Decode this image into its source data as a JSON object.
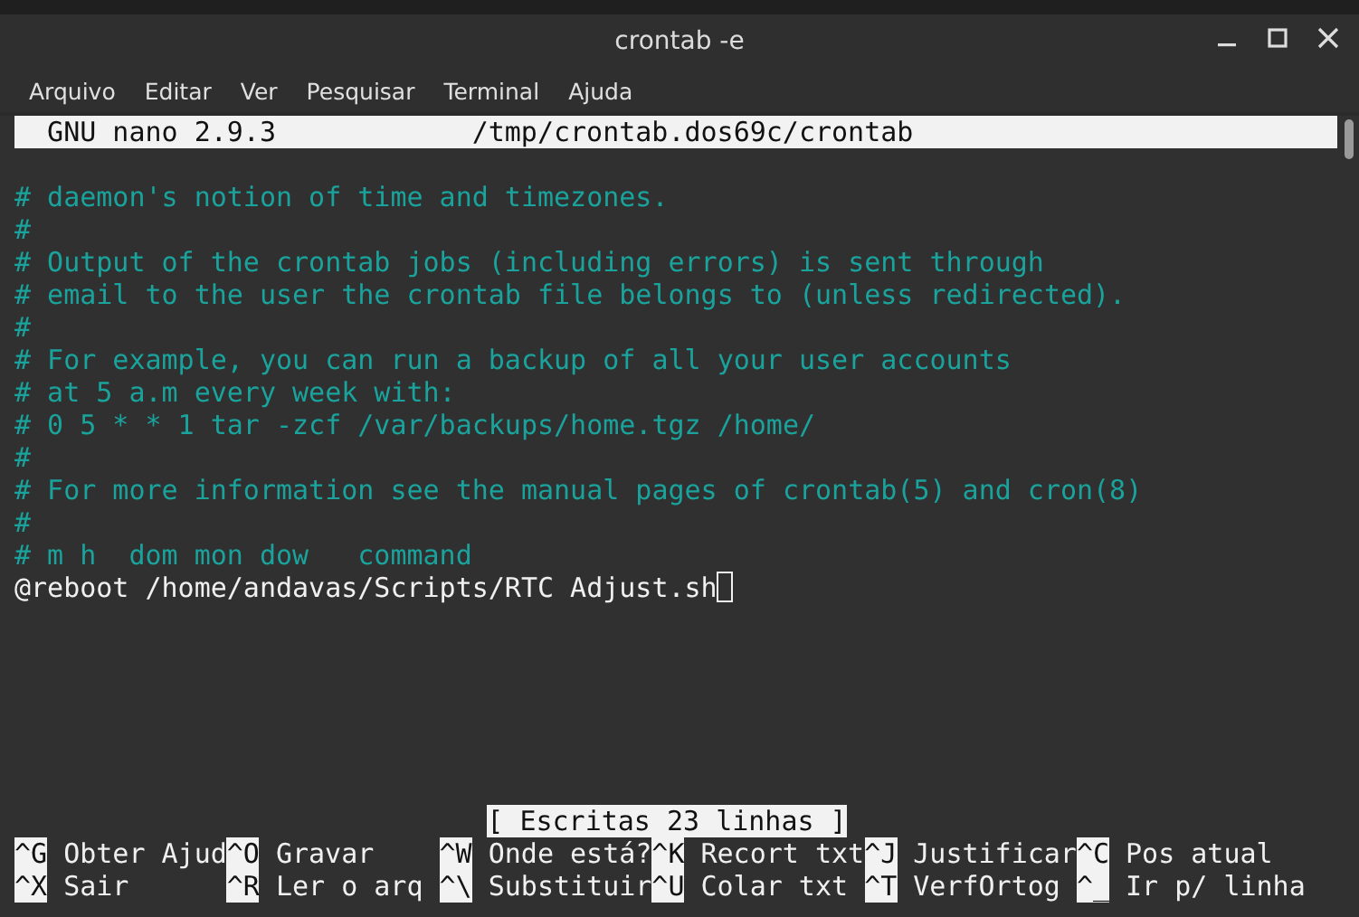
{
  "window": {
    "title": "crontab -e"
  },
  "menu": [
    "Arquivo",
    "Editar",
    "Ver",
    "Pesquisar",
    "Terminal",
    "Ajuda"
  ],
  "nano_header": {
    "version": "GNU nano 2.9.3",
    "file": "/tmp/crontab.dos69c/crontab"
  },
  "lines": [
    {
      "kind": "comment",
      "text": "# daemon's notion of time and timezones."
    },
    {
      "kind": "comment",
      "text": "#"
    },
    {
      "kind": "comment",
      "text": "# Output of the crontab jobs (including errors) is sent through"
    },
    {
      "kind": "comment",
      "text": "# email to the user the crontab file belongs to (unless redirected)."
    },
    {
      "kind": "comment",
      "text": "#"
    },
    {
      "kind": "comment",
      "text": "# For example, you can run a backup of all your user accounts"
    },
    {
      "kind": "comment",
      "text": "# at 5 a.m every week with:"
    },
    {
      "kind": "comment",
      "text": "# 0 5 * * 1 tar -zcf /var/backups/home.tgz /home/"
    },
    {
      "kind": "comment",
      "text": "#"
    },
    {
      "kind": "comment",
      "text": "# For more information see the manual pages of crontab(5) and cron(8)"
    },
    {
      "kind": "comment",
      "text": "#"
    },
    {
      "kind": "comment",
      "text": "# m h  dom mon dow   command"
    },
    {
      "kind": "code",
      "text": "@reboot /home/andavas/Scripts/RTC Adjust.sh",
      "cursor": true
    }
  ],
  "status": "[ Escritas 23 linhas ]",
  "shortcuts": [
    [
      {
        "key": "^G",
        "label": "Obter Ajud"
      },
      {
        "key": "^O",
        "label": "Gravar"
      },
      {
        "key": "^W",
        "label": "Onde está?"
      },
      {
        "key": "^K",
        "label": "Recort txt"
      },
      {
        "key": "^J",
        "label": "Justificar"
      },
      {
        "key": "^C",
        "label": "Pos atual"
      }
    ],
    [
      {
        "key": "^X",
        "label": "Sair"
      },
      {
        "key": "^R",
        "label": "Ler o arq"
      },
      {
        "key": "^\\",
        "label": "Substituir"
      },
      {
        "key": "^U",
        "label": "Colar txt"
      },
      {
        "key": "^T",
        "label": "VerfOrtog"
      },
      {
        "key": "^_",
        "label": "Ir p/ linha"
      }
    ]
  ]
}
